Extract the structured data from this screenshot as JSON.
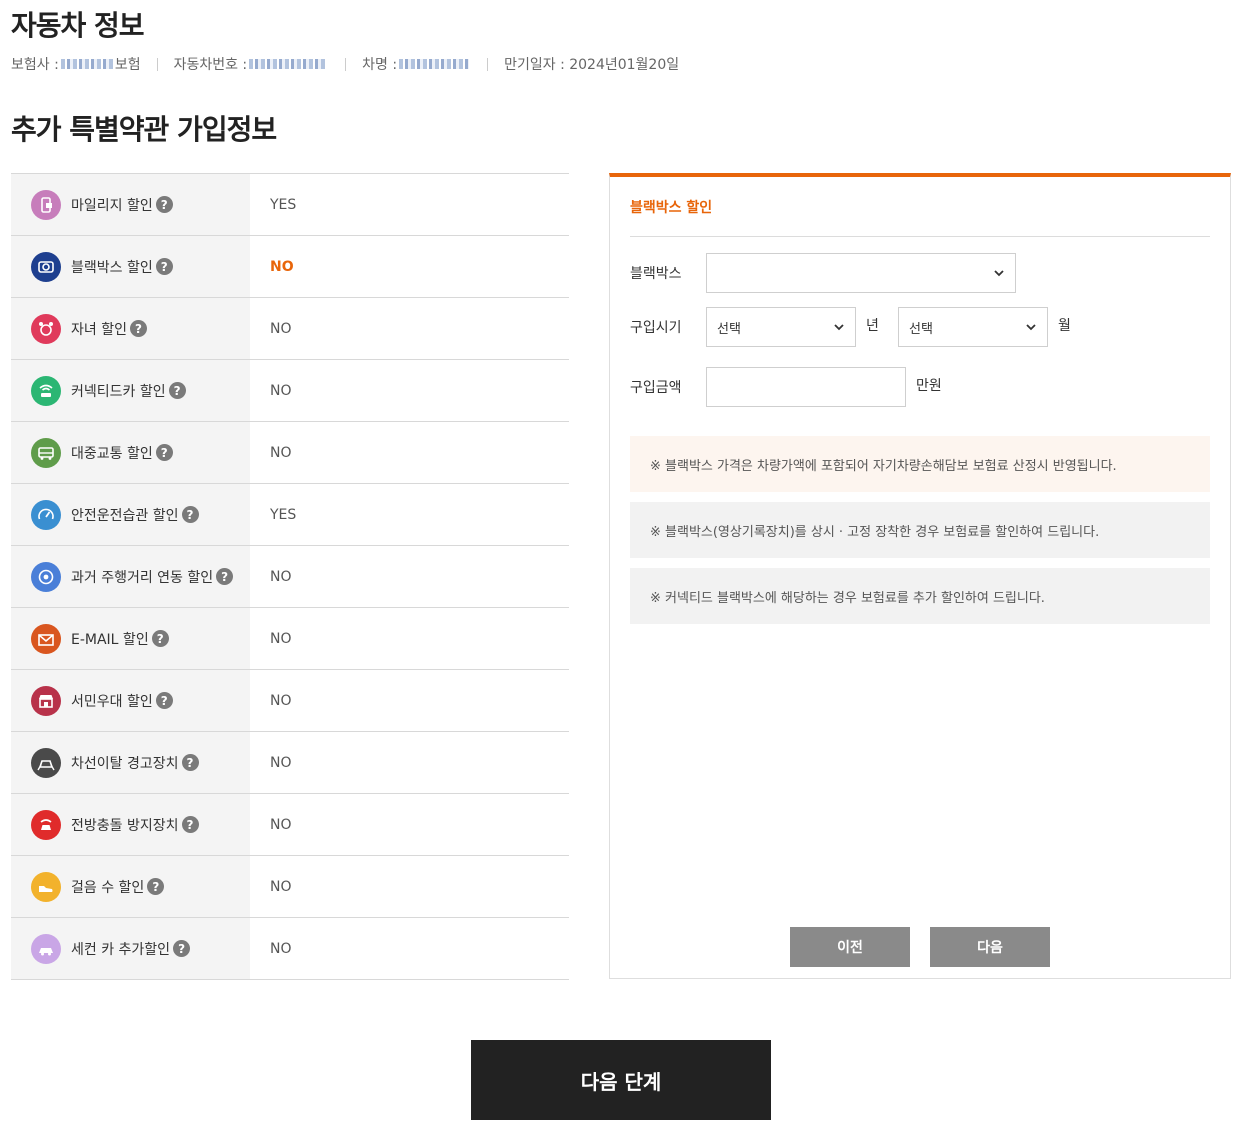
{
  "header": {
    "title": "자동차 정보",
    "insurer_label": "보험사 :",
    "insurer_suffix": "보험",
    "plate_label": "자동차번호 :",
    "car_label": "차명 :",
    "expiry_label": "만기일자 : 2024년01월20일"
  },
  "section_title": "추가 특별약관 가입정보",
  "discounts": [
    {
      "label": "마일리지 할인",
      "value": "YES",
      "icon": "phone-icon",
      "color": "#c77dbb"
    },
    {
      "label": "블랙박스 할인",
      "value": "NO",
      "icon": "camera-icon",
      "color": "#1e3f8f",
      "highlight": true
    },
    {
      "label": "자녀 할인",
      "value": "NO",
      "icon": "child-icon",
      "color": "#e03a5b"
    },
    {
      "label": "커넥티드카 할인",
      "value": "NO",
      "icon": "wifi-car-icon",
      "color": "#2bb673"
    },
    {
      "label": "대중교통 할인",
      "value": "NO",
      "icon": "bus-icon",
      "color": "#5f9c4a"
    },
    {
      "label": "안전운전습관 할인",
      "value": "YES",
      "icon": "speedometer-icon",
      "color": "#3a8fd1"
    },
    {
      "label": "과거 주행거리 연동 할인",
      "value": "NO",
      "icon": "odometer-icon",
      "color": "#4a7fd8"
    },
    {
      "label": "E-MAIL 할인",
      "value": "NO",
      "icon": "email-icon",
      "color": "#d9561f"
    },
    {
      "label": "서민우대 할인",
      "value": "NO",
      "icon": "shop-icon",
      "color": "#b8324a"
    },
    {
      "label": "차선이탈 경고장치",
      "value": "NO",
      "icon": "lane-car-icon",
      "color": "#4a4a4a"
    },
    {
      "label": "전방충돌 방지장치",
      "value": "NO",
      "icon": "front-car-icon",
      "color": "#e02b2b"
    },
    {
      "label": "걸음 수 할인",
      "value": "NO",
      "icon": "shoe-icon",
      "color": "#f2b22c"
    },
    {
      "label": "세컨 카 추가할인",
      "value": "NO",
      "icon": "second-car-icon",
      "color": "#c9a6e6"
    }
  ],
  "help_mark": "?",
  "panel": {
    "title": "블랙박스 할인",
    "blackbox_label": "블랙박스",
    "blackbox_value": "",
    "purchase_time_label": "구입시기",
    "year_select": "선택",
    "year_unit": "년",
    "month_select": "선택",
    "month_unit": "월",
    "price_label": "구입금액",
    "price_value": "",
    "price_unit": "만원",
    "notes": [
      "※ 블랙박스 가격은 차량가액에 포함되어 자기차량손해담보 보험료 산정시 반영됩니다.",
      "※ 블랙박스(영상기록장치)를 상시 · 고정 장착한 경우 보험료를 할인하여 드립니다.",
      "※ 커넥티드 블랙박스에 해당하는 경우 보험료를 추가 할인하여 드립니다."
    ],
    "note_colors": [
      "#fdf5ef",
      "#f2f2f2",
      "#f2f2f2"
    ],
    "prev_button": "이전",
    "next_button": "다음"
  },
  "next_step_button": "다음 단계",
  "colors": {
    "accent": "#e8650a",
    "dark_button": "#222222",
    "gray_button": "#8a8a8a"
  }
}
